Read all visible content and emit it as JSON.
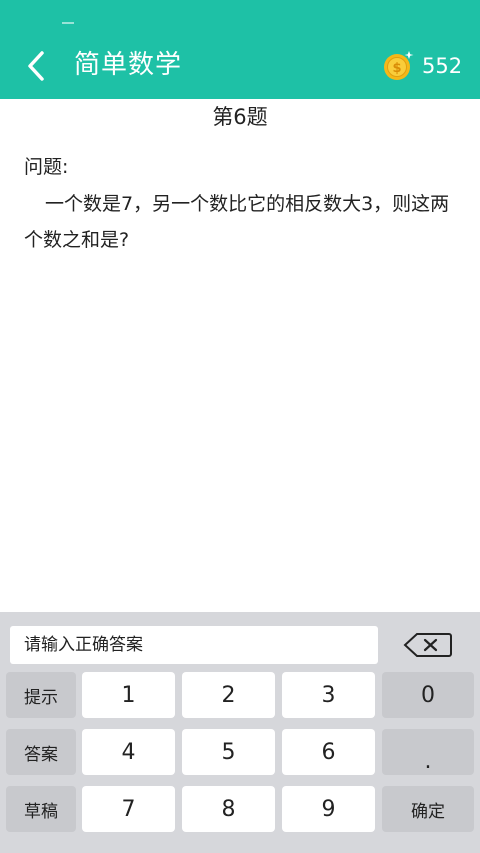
{
  "header": {
    "title": "简单数学",
    "coins": "552",
    "colors": {
      "bar": "#1ec1a6",
      "coin": "#f5b818"
    }
  },
  "question": {
    "number_label": "第6题",
    "label": "问题:",
    "text": "一个数是7，另一个数比它的相反数大3，则这两个数之和是?"
  },
  "keyboard": {
    "placeholder": "请输入正确答案",
    "value": "",
    "rows": [
      {
        "fn": "提示",
        "digits": [
          "1",
          "2",
          "3"
        ],
        "right": "0"
      },
      {
        "fn": "答案",
        "digits": [
          "4",
          "5",
          "6"
        ],
        "right": "."
      },
      {
        "fn": "草稿",
        "digits": [
          "7",
          "8",
          "9"
        ],
        "right": "确定"
      }
    ]
  }
}
